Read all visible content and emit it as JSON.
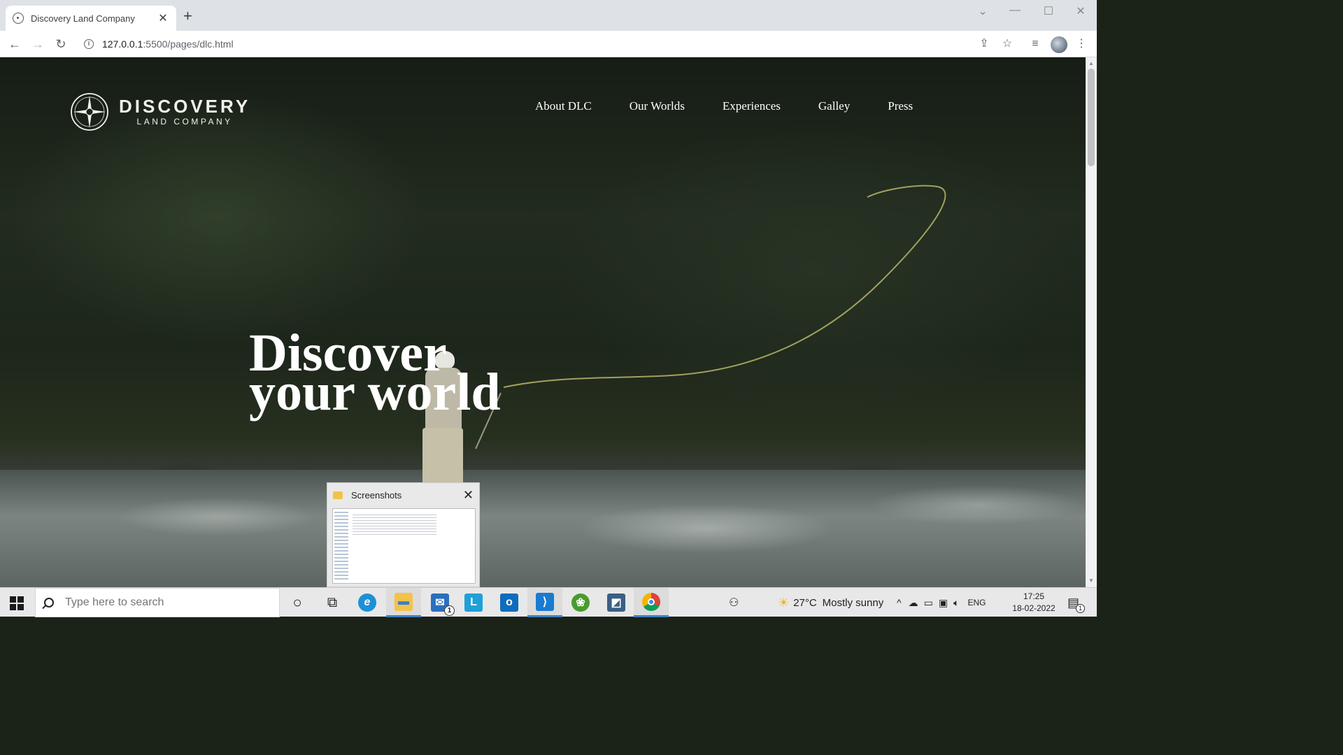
{
  "browser": {
    "tab_title": "Discovery Land Company",
    "tab_close": "✕",
    "new_tab": "+",
    "url_host": "127.0.0.1",
    "url_path": ":5500/pages/dlc.html",
    "window_controls": [
      "⌄",
      "—",
      "☐",
      "✕"
    ]
  },
  "site": {
    "logo_word": "DISCOVERY",
    "logo_sub": "LAND COMPANY",
    "nav": [
      "About DLC",
      "Our Worlds",
      "Experiences",
      "Galley",
      "Press"
    ],
    "hero_line1": "Discover",
    "hero_line2": "your world"
  },
  "preview": {
    "title": "Screenshots",
    "close": "✕"
  },
  "taskbar": {
    "search_placeholder": "Type here to search",
    "apps": [
      {
        "name": "cortana-icon",
        "glyph": "○",
        "color": "transparent"
      },
      {
        "name": "task-view-icon",
        "glyph": "⧉",
        "color": "transparent"
      },
      {
        "name": "internet-explorer-icon",
        "glyph": "e",
        "color": "#1e90d6"
      },
      {
        "name": "file-explorer-icon",
        "glyph": "▬",
        "color": "#f3c24a"
      },
      {
        "name": "mail-icon",
        "glyph": "✉",
        "color": "#2a6fbd"
      },
      {
        "name": "l-app-icon",
        "glyph": "L",
        "color": "#1ea0d8"
      },
      {
        "name": "outlook-icon",
        "glyph": "o",
        "color": "#0f6cbd"
      },
      {
        "name": "vscode-icon",
        "glyph": "⟩",
        "color": "#1a7bd1"
      },
      {
        "name": "green-app-icon",
        "glyph": "❀",
        "color": "#4a9a2e"
      },
      {
        "name": "mysql-workbench-icon",
        "glyph": "◩",
        "color": "#3b5f84"
      },
      {
        "name": "chrome-icon",
        "glyph": "◉",
        "color": "#db4437"
      }
    ],
    "mail_badge": "1",
    "weather": "27°C",
    "weather_desc": "Mostly sunny",
    "lang": "ENG",
    "time": "17:25",
    "date": "18-02-2022",
    "notification_count": "1"
  }
}
